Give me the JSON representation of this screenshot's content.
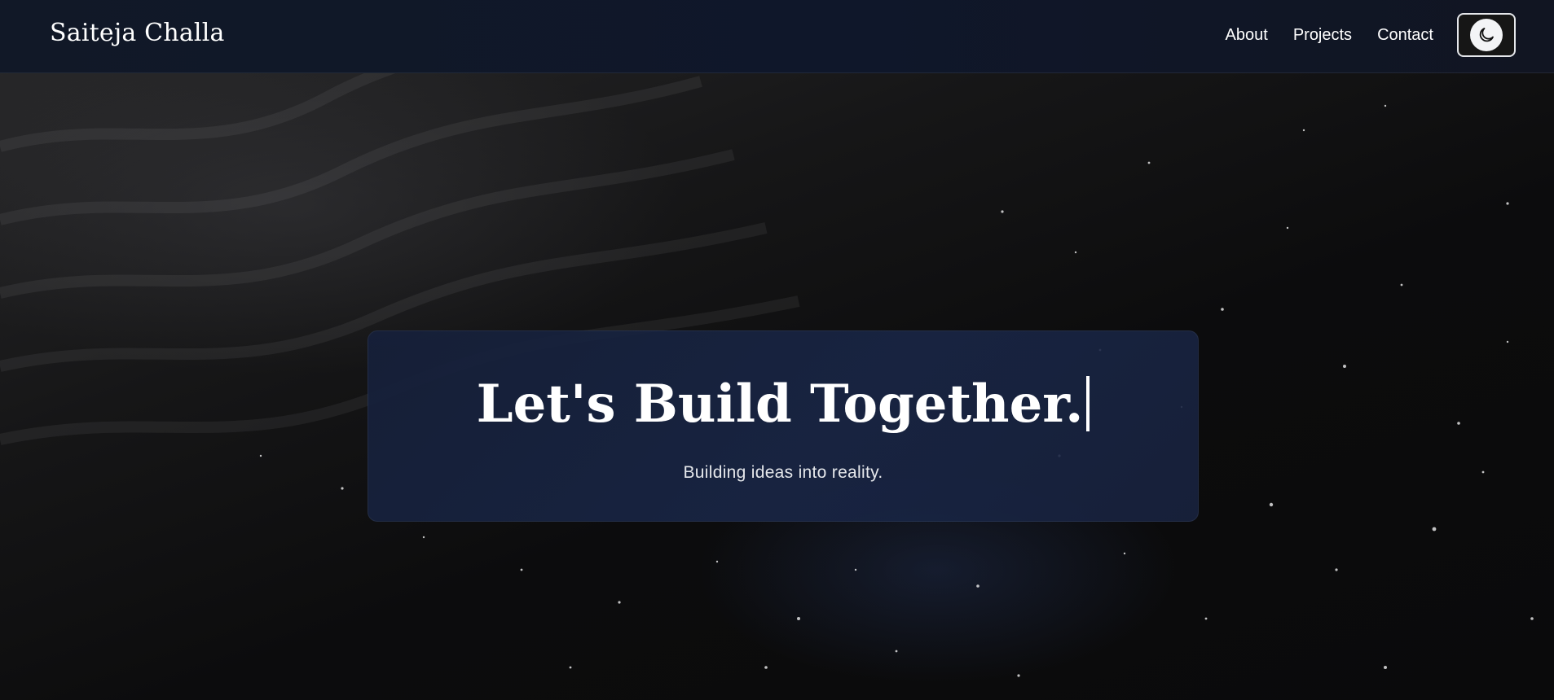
{
  "header": {
    "brand": "Saiteja Challa",
    "nav": [
      {
        "label": "About"
      },
      {
        "label": "Projects"
      },
      {
        "label": "Contact"
      }
    ],
    "theme_toggle": {
      "icon": "moon-icon"
    }
  },
  "hero": {
    "title": "Let's Build Together.",
    "subtitle": "Building ideas into reality."
  },
  "colors": {
    "header_bg": "#0f172a",
    "card_bg": "#16203a",
    "text": "#ffffff"
  }
}
